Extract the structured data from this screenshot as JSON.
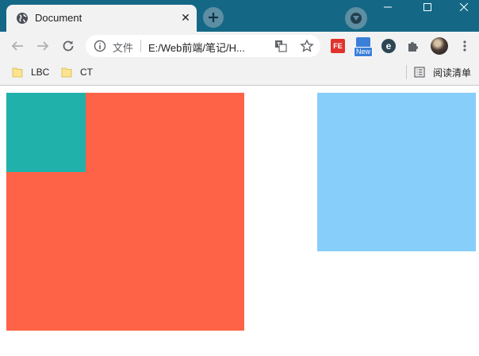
{
  "tab": {
    "title": "Document",
    "close_glyph": "✕"
  },
  "window_controls": {
    "minimize_icon": "minimize-icon",
    "maximize_icon": "maximize-icon",
    "close_icon": "close-icon"
  },
  "address_bar": {
    "scheme_label": "文件",
    "url": "E:/Web前端/笔记/H..."
  },
  "extensions": {
    "fe_label": "FE",
    "new_badge": "New",
    "e_label": "e"
  },
  "bookmarks": [
    {
      "label": "LBC"
    },
    {
      "label": "CT"
    }
  ],
  "reading_list": {
    "label": "阅读清单"
  },
  "colors": {
    "title_bar": "#146886",
    "toolbar": "#f2f2f2",
    "outer_box": "#ff6347",
    "inner_box": "#20b2aa",
    "side_box": "#87cefa"
  }
}
